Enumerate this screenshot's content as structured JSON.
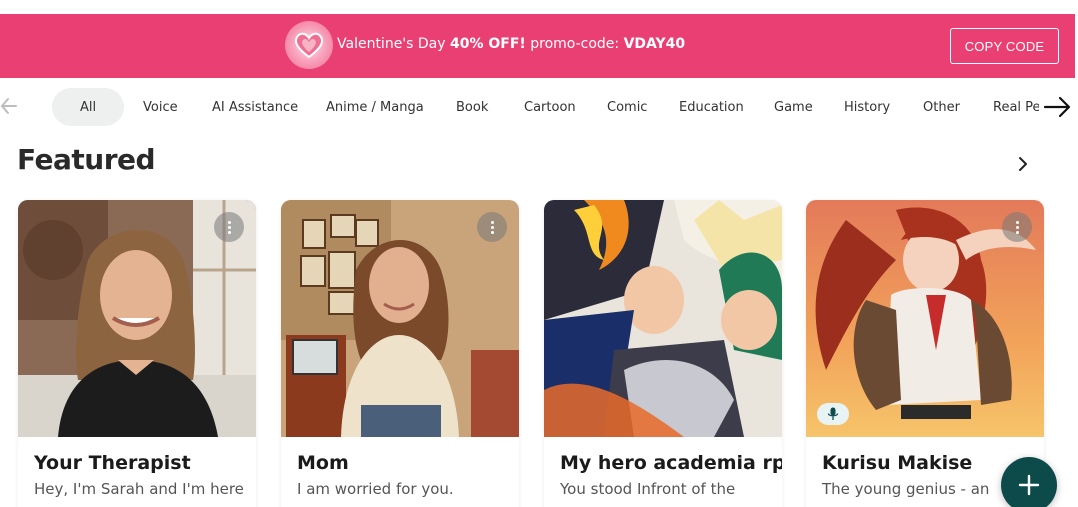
{
  "banner": {
    "text_prefix": "Valentine's Day ",
    "text_discount": "40% OFF!",
    "text_middle": " promo-code: ",
    "text_code": "VDAY40",
    "copy_label": "COPY CODE",
    "color": "#ea3f73"
  },
  "categories": [
    {
      "label": "All",
      "active": true
    },
    {
      "label": "Voice"
    },
    {
      "label": "AI Assistance"
    },
    {
      "label": "Anime / Manga"
    },
    {
      "label": "Book"
    },
    {
      "label": "Cartoon"
    },
    {
      "label": "Comic"
    },
    {
      "label": "Education"
    },
    {
      "label": "Game"
    },
    {
      "label": "History"
    },
    {
      "label": "Other"
    },
    {
      "label": "Real Pe"
    }
  ],
  "featured": {
    "title": "Featured",
    "cards": [
      {
        "name": "Your Therapist",
        "description": "Hey, I'm Sarah and I'm here",
        "image": "woman-portrait-photo"
      },
      {
        "name": "Mom",
        "description": "I am worried for you.",
        "image": "mom-portrait-photo"
      },
      {
        "name": "My hero academia rp",
        "description": "You stood Infront of the",
        "image": "anime-heroes-art"
      },
      {
        "name": "Kurisu Makise",
        "description": "The young genius - an",
        "image": "anime-girl-art",
        "voice": true
      }
    ]
  },
  "fab": {
    "icon": "plus-icon",
    "color": "#0d4b4a"
  }
}
